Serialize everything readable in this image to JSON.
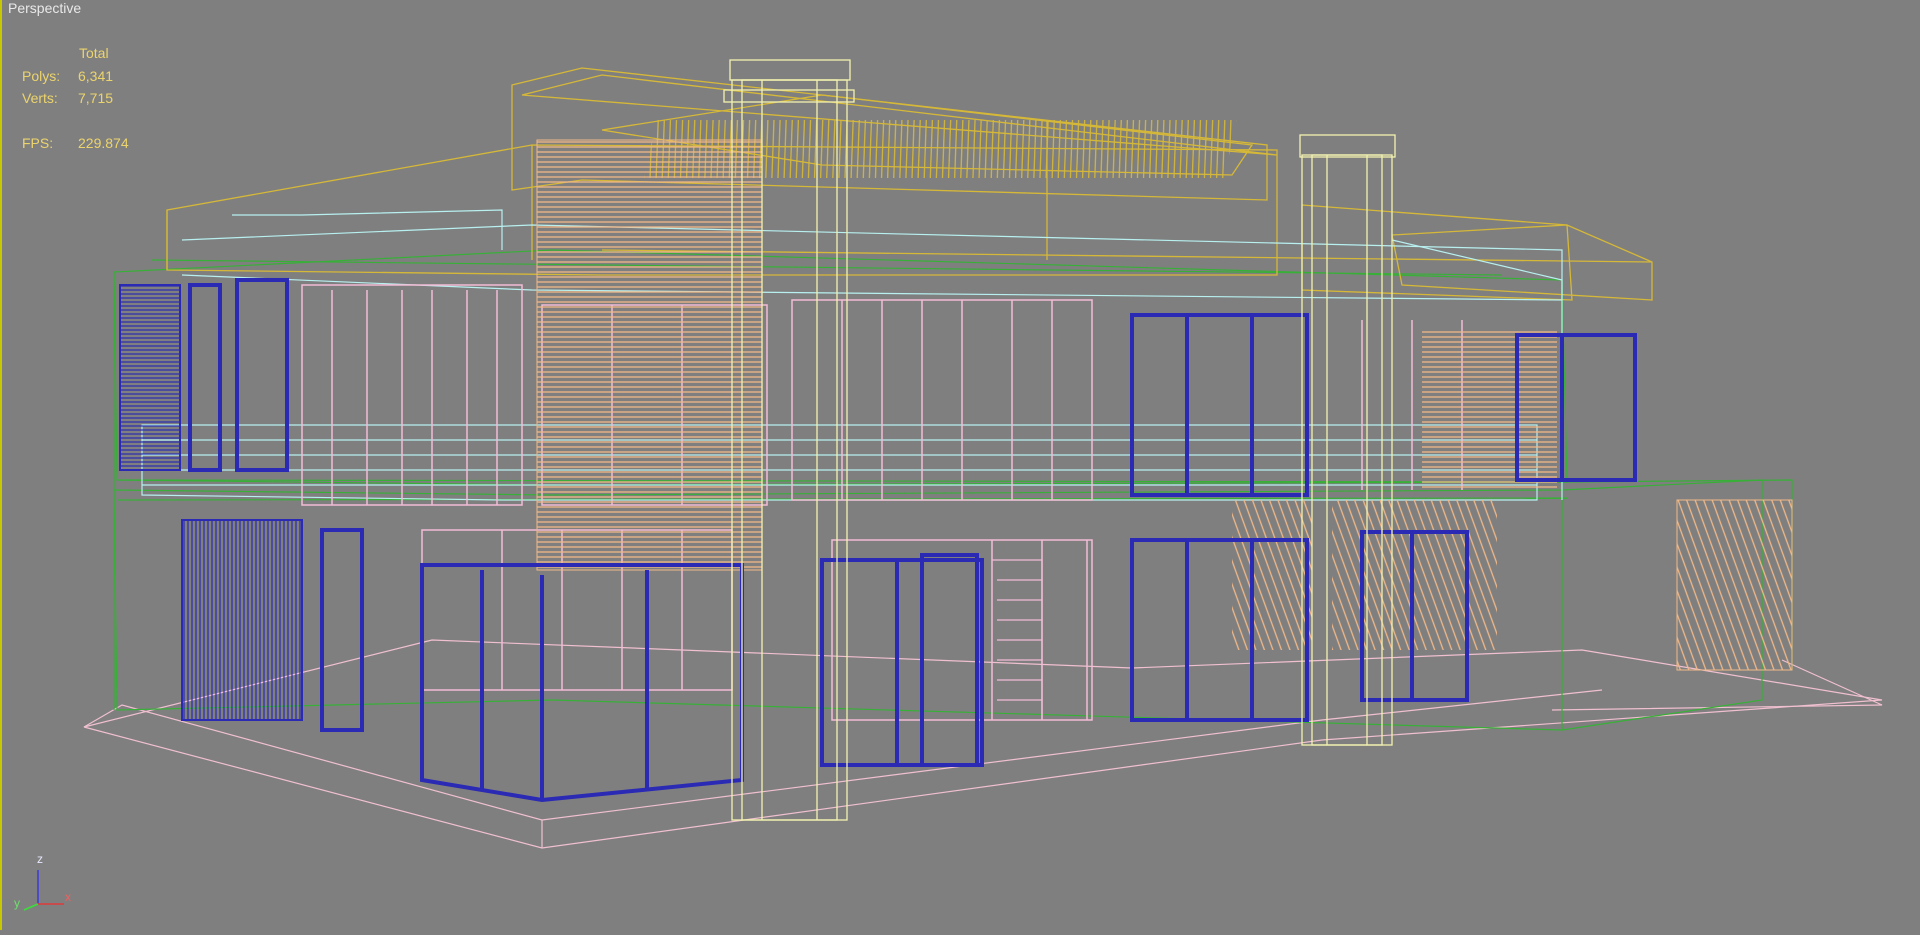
{
  "viewport": {
    "label": "Perspective",
    "background": "#7f7f7f",
    "active_border_color": "#c8c800"
  },
  "stats": {
    "header": "Total",
    "polys_label": "Polys:",
    "polys_value": "6,341",
    "verts_label": "Verts:",
    "verts_value": "7,715",
    "fps_label": "FPS:",
    "fps_value": "229.874",
    "text_color": "#ecd46c"
  },
  "axis_gizmo": {
    "z": "z",
    "y": "y",
    "x": "x"
  },
  "wire_colors": {
    "roof_yellow": "#d6b838",
    "column_cream": "#f2f2b0",
    "window_blue": "#2a2ab4",
    "frame_pink": "#f2bcd6",
    "rail_cyan": "#b8f0f0",
    "outline_green": "#38b038",
    "louver_orange": "#f0b888",
    "ground_pink": "#f0c0d0"
  }
}
